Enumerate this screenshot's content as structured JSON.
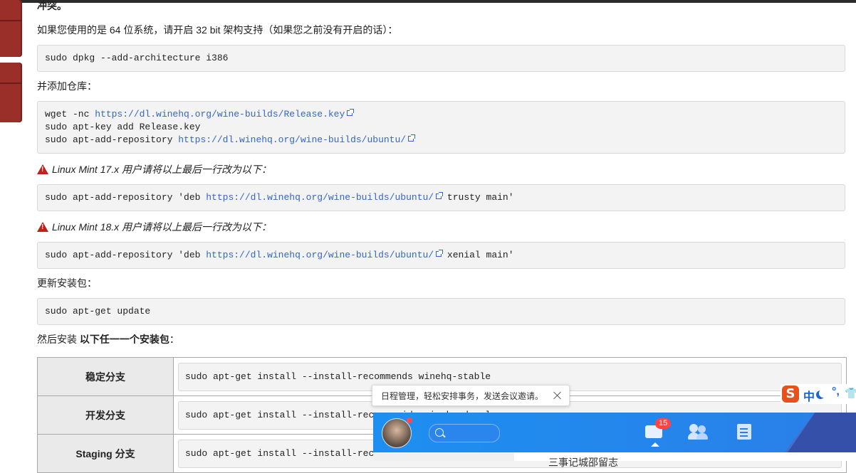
{
  "doc": {
    "heading_fragment": "冲突。",
    "p_arch": "如果您使用的是 64 位系统，请开启 32 bit 架构支持（如果您之前没有开启的话）：",
    "code_arch": "sudo dpkg --add-architecture i386",
    "p_repo": "并添加仓库：",
    "code_repo": {
      "line1_prefix": "wget -nc ",
      "line1_link": "https://dl.winehq.org/wine-builds/Release.key",
      "line2": "sudo apt-key add Release.key",
      "line3_prefix": "sudo apt-add-repository ",
      "line3_link": "https://dl.winehq.org/wine-builds/ubuntu/"
    },
    "warn_mint17": "Linux Mint 17.x 用户请将以上最后一行改为以下：",
    "code_mint17": {
      "prefix": "sudo apt-add-repository 'deb ",
      "link": "https://dl.winehq.org/wine-builds/ubuntu/",
      "suffix": " trusty main'"
    },
    "warn_mint18": "Linux Mint 18.x 用户请将以上最后一行改为以下：",
    "code_mint18": {
      "prefix": "sudo apt-add-repository 'deb ",
      "link": "https://dl.winehq.org/wine-builds/ubuntu/",
      "suffix": " xenial main'"
    },
    "p_update": "更新安装包：",
    "code_update": "sudo apt-get update",
    "p_install_prefix": "然后安装 ",
    "p_install_bold": "以下任一一个安装包",
    "p_install_suffix": "：",
    "packages": [
      {
        "name": "稳定分支",
        "cmd": "sudo apt-get install --install-recommends winehq-stable"
      },
      {
        "name": "开发分支",
        "cmd": "sudo apt-get install --install-recomme.ids winehq-devel"
      },
      {
        "name": "Staging 分支",
        "cmd": "sudo apt-get install --install-rec"
      }
    ]
  },
  "tooltip": {
    "text": "日程管理，轻松安排事务，发送会议邀请。"
  },
  "ime": {
    "logo": "S",
    "mode": "中",
    "punct": "°,",
    "shirt": "👕"
  },
  "chat": {
    "unread_count": "15",
    "below_text": "三事记城邵留志"
  },
  "colors": {
    "link": "#3366cc",
    "warning": "#c0201b",
    "chat_bar": "#1d8ff0",
    "badge": "#ff4444"
  }
}
